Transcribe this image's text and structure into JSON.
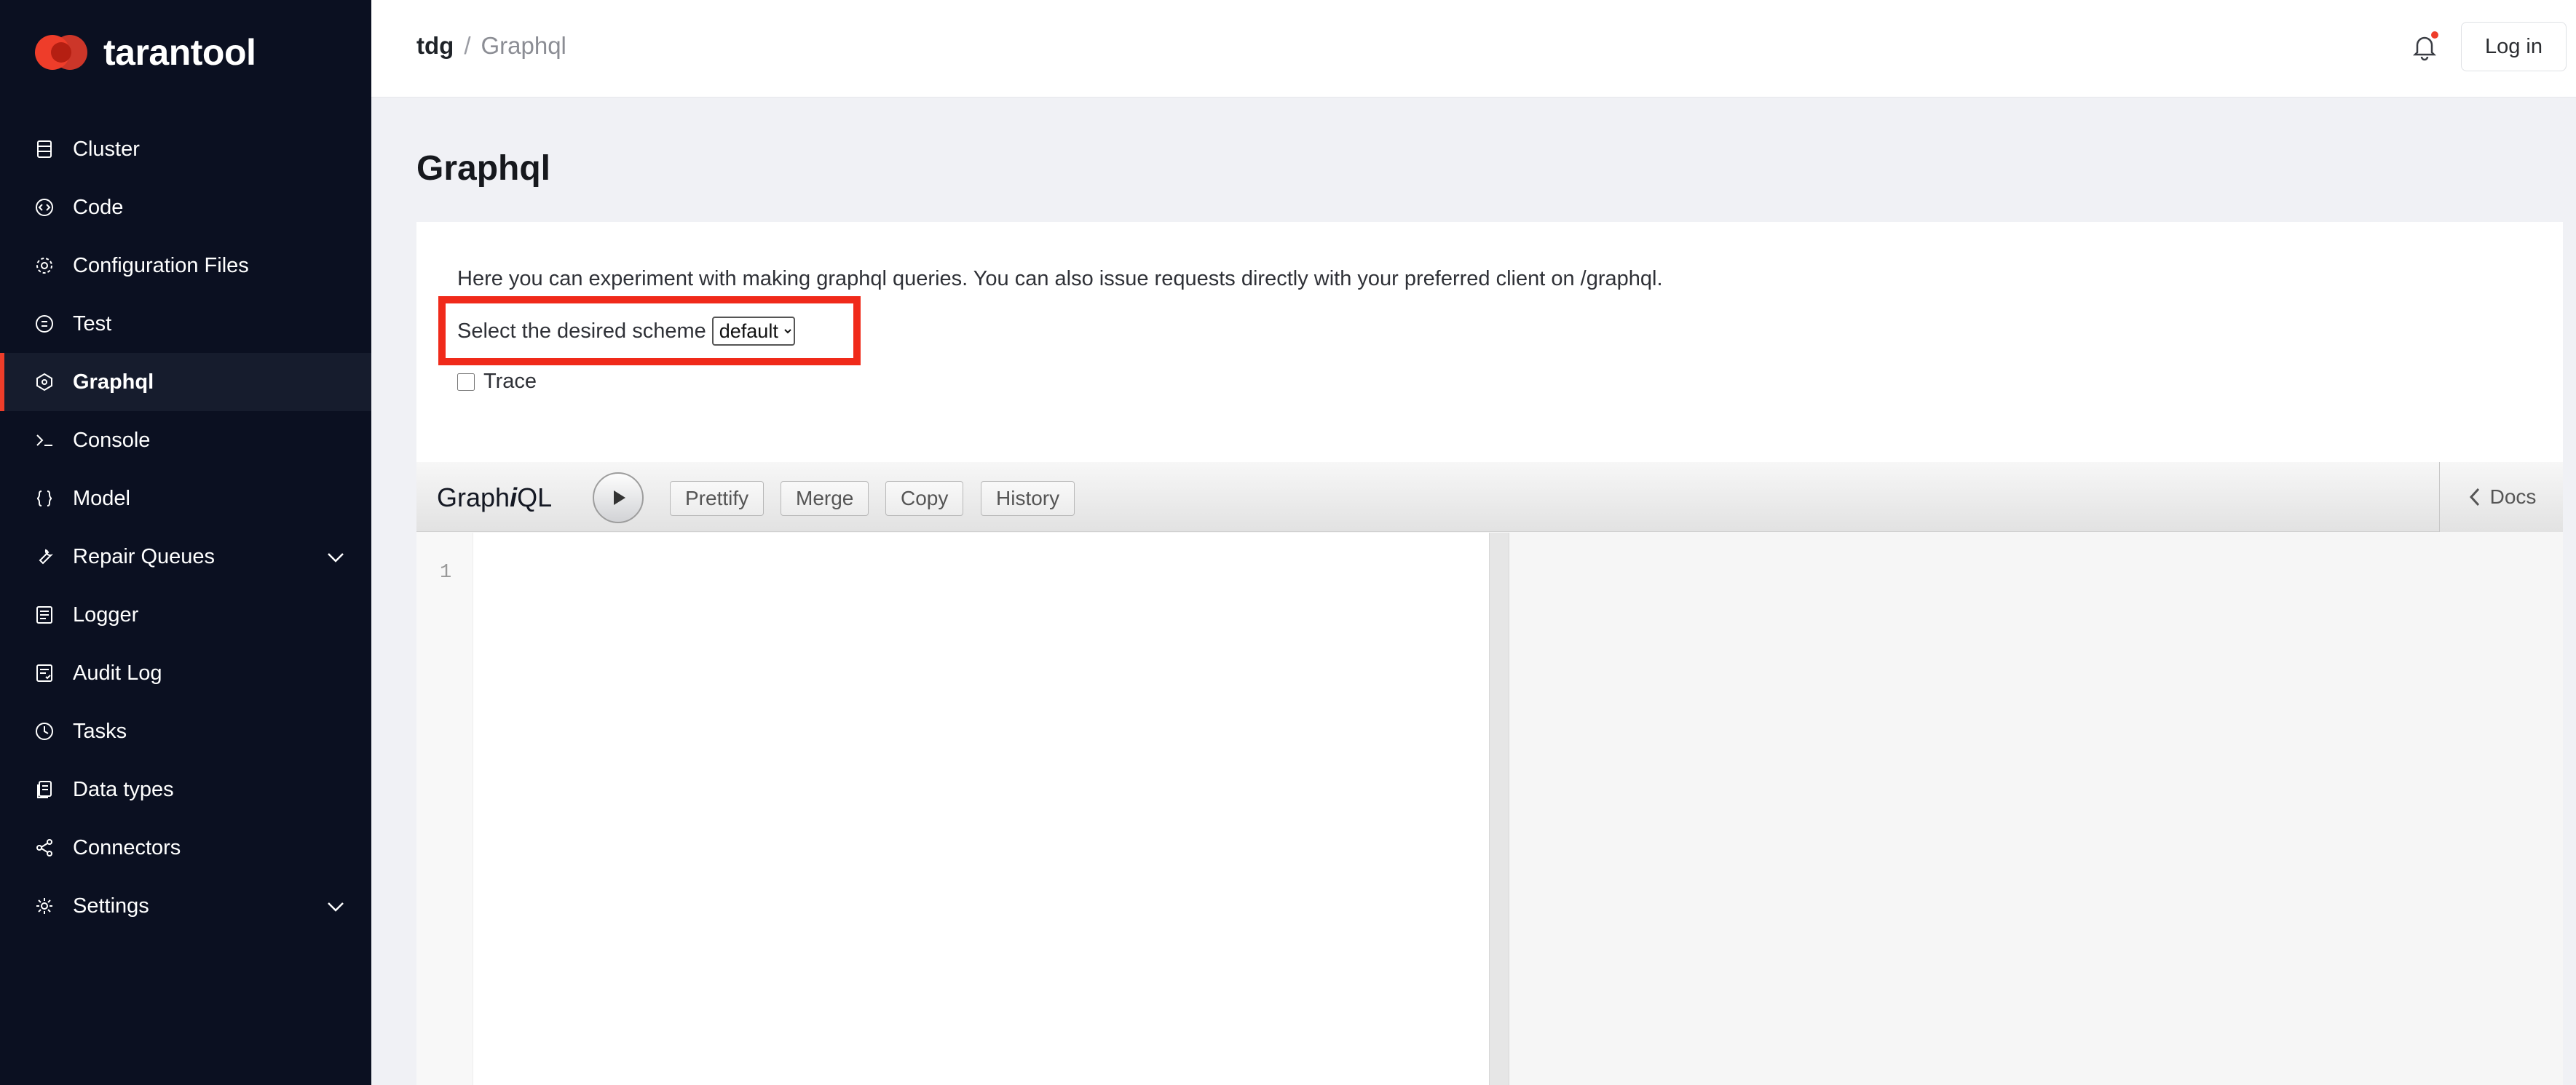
{
  "brand": {
    "name": "tarantool",
    "accent": "#ee3d2a"
  },
  "sidebar": {
    "items": [
      {
        "label": "Cluster",
        "icon": "server-icon"
      },
      {
        "label": "Code",
        "icon": "code-icon"
      },
      {
        "label": "Configuration Files",
        "icon": "gear-icon"
      },
      {
        "label": "Test",
        "icon": "test-icon"
      },
      {
        "label": "Graphql",
        "icon": "graphql-icon",
        "active": true
      },
      {
        "label": "Console",
        "icon": "terminal-icon"
      },
      {
        "label": "Model",
        "icon": "braces-icon"
      },
      {
        "label": "Repair Queues",
        "icon": "wrench-icon",
        "expandable": true
      },
      {
        "label": "Logger",
        "icon": "log-icon"
      },
      {
        "label": "Audit Log",
        "icon": "audit-log-icon"
      },
      {
        "label": "Tasks",
        "icon": "clock-icon"
      },
      {
        "label": "Data types",
        "icon": "data-types-icon"
      },
      {
        "label": "Connectors",
        "icon": "share-icon"
      },
      {
        "label": "Settings",
        "icon": "settings-icon",
        "expandable": true
      }
    ]
  },
  "header": {
    "breadcrumb_root": "tdg",
    "breadcrumb_sep": "/",
    "breadcrumb_current": "Graphql",
    "login_label": "Log in"
  },
  "page": {
    "title": "Graphql",
    "description": "Here you can experiment with making graphql queries. You can also issue requests directly with your preferred client on /graphql.",
    "scheme_label": "Select the desired scheme",
    "scheme_value": "default",
    "trace_label": "Trace"
  },
  "graphiql": {
    "title_pre": "Graph",
    "title_em": "i",
    "title_post": "QL",
    "buttons": {
      "prettify": "Prettify",
      "merge": "Merge",
      "copy": "Copy",
      "history": "History"
    },
    "docs_label": "Docs",
    "line_number": "1"
  }
}
